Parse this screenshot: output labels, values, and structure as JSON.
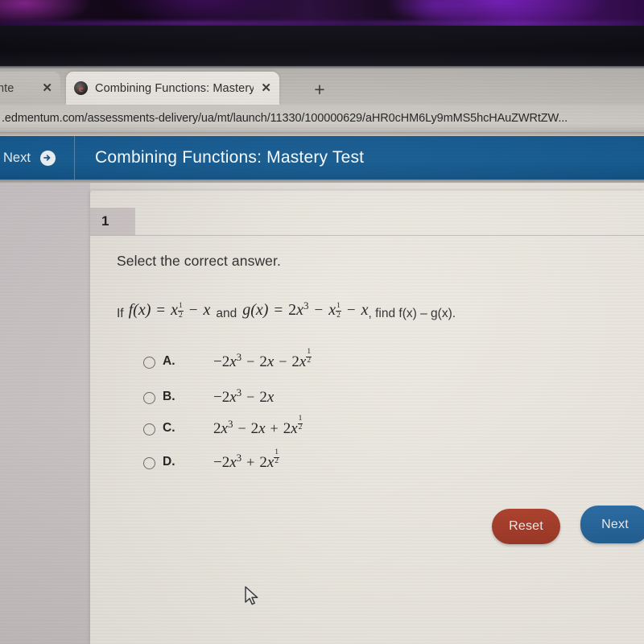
{
  "browser": {
    "tabs": [
      {
        "title": "t Cente",
        "close_label": "✕",
        "active": false
      },
      {
        "title": "Combining Functions: Mastery Te",
        "close_label": "✕",
        "active": true,
        "favicon_letter": "e"
      }
    ],
    "new_tab_label": "+",
    "url": ".edmentum.com/assessments-delivery/ua/mt/launch/11330/100000629/aHR0cHM6Ly9mMS5hcHAuZWRtZW..."
  },
  "app_header": {
    "next_label": "Next",
    "next_arrow": "➜",
    "title": "Combining Functions: Mastery Test",
    "bg_color": "#14588f"
  },
  "question": {
    "number": "1",
    "instruction": "Select the correct answer.",
    "stem": {
      "if_word": "If",
      "f_name": "f(x)",
      "eq": "=",
      "f_base": "x",
      "f_exp_num": "1",
      "f_exp_den": "2",
      "minus": "−",
      "f_term2": "x",
      "and_word": "and",
      "g_name": "g(x)",
      "g_term1_coef": "2",
      "g_term1_base": "x",
      "g_term1_pow": "3",
      "g_term2_base": "x",
      "g_exp_num": "1",
      "g_exp_den": "2",
      "g_term3": "x",
      "find_text": ", find f(x) – g(x)."
    },
    "options": [
      {
        "letter": "A.",
        "selected": false,
        "parts": [
          {
            "t": "−2"
          },
          {
            "t": "x",
            "i": true
          },
          {
            "t": "3",
            "sup": true
          },
          {
            "t": "−",
            "op": true
          },
          {
            "t": "2"
          },
          {
            "t": "x",
            "i": true
          },
          {
            "t": "−",
            "op": true
          },
          {
            "t": "2"
          },
          {
            "t": "x",
            "i": true
          },
          {
            "t": "1/2",
            "frac": true
          }
        ],
        "plain": "−2x³ − 2x − 2x^(1/2)"
      },
      {
        "letter": "B.",
        "selected": false,
        "parts": [
          {
            "t": "−2"
          },
          {
            "t": "x",
            "i": true
          },
          {
            "t": "3",
            "sup": true
          },
          {
            "t": "−",
            "op": true
          },
          {
            "t": "2"
          },
          {
            "t": "x",
            "i": true
          }
        ],
        "plain": "−2x³ − 2x"
      },
      {
        "letter": "C.",
        "selected": false,
        "parts": [
          {
            "t": "2"
          },
          {
            "t": "x",
            "i": true
          },
          {
            "t": "3",
            "sup": true
          },
          {
            "t": "−",
            "op": true
          },
          {
            "t": "2"
          },
          {
            "t": "x",
            "i": true
          },
          {
            "t": "+",
            "op": true
          },
          {
            "t": "2"
          },
          {
            "t": "x",
            "i": true
          },
          {
            "t": "1/2",
            "frac": true
          }
        ],
        "plain": "2x³ − 2x + 2x^(1/2)"
      },
      {
        "letter": "D.",
        "selected": false,
        "parts": [
          {
            "t": "−2"
          },
          {
            "t": "x",
            "i": true
          },
          {
            "t": "3",
            "sup": true
          },
          {
            "t": "+",
            "op": true
          },
          {
            "t": "2"
          },
          {
            "t": "x",
            "i": true
          },
          {
            "t": "1/2",
            "frac": true
          }
        ],
        "plain": "−2x³ + 2x^(1/2)"
      }
    ]
  },
  "footer": {
    "reset_label": "Reset",
    "reset_color": "#a83b27",
    "next_label": "Next",
    "next_color": "#2a6ea8"
  }
}
